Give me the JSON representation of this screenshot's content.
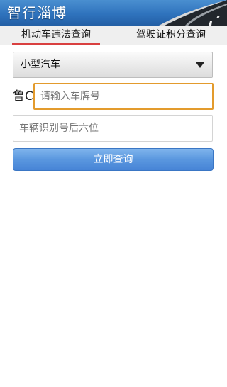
{
  "header": {
    "title": "智行淄博"
  },
  "tabs": [
    {
      "label": "机动车违法查询",
      "active": true
    },
    {
      "label": "驾驶证积分查询",
      "active": false
    }
  ],
  "form": {
    "vehicle_type": "小型汽车",
    "plate_prefix": "鲁C",
    "plate_placeholder": "请输入车牌号",
    "vin_placeholder": "车辆识别号后六位",
    "submit_label": "立即查询"
  },
  "colors": {
    "header_blue": "#2f73bd",
    "tab_underline": "#d94040",
    "input_focus": "#e39b2d",
    "button_blue": "#5a97df"
  }
}
